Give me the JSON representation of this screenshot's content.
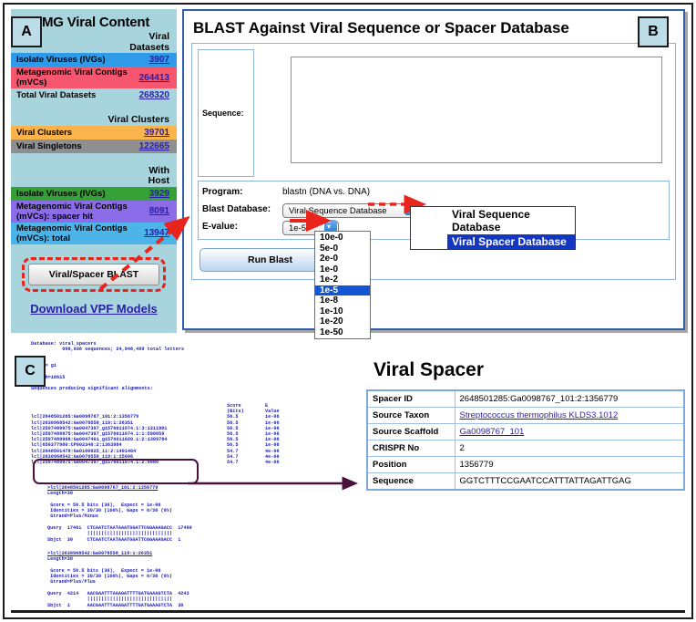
{
  "tags": {
    "a": "A",
    "b": "B",
    "c": "C"
  },
  "panel_a": {
    "title": "IMG Viral Content",
    "colheads": {
      "datasets": [
        "Viral",
        "Datasets"
      ],
      "clusters": "Viral Clusters",
      "host": [
        "With",
        "Host"
      ]
    },
    "datasets_rows": [
      {
        "label": "Isolate Viruses (IVGs)",
        "value": "3907",
        "color": "#2e9ae8"
      },
      {
        "label": "Metagenomic Viral Contigs (mVCs)",
        "value": "264413",
        "color": "#f7566f"
      },
      {
        "label": "Total Viral Datasets",
        "value": "268320",
        "color": "transparent"
      }
    ],
    "cluster_rows": [
      {
        "label": "Viral Clusters",
        "value": "39701",
        "color": "#f9b54c"
      },
      {
        "label": "Viral Singletons",
        "value": "122665",
        "color": "#8f8f8f"
      }
    ],
    "host_rows": [
      {
        "label": "Isolate Viruses (IVGs)",
        "value": "3929",
        "color": "#35a035"
      },
      {
        "label": "Metagenomic Viral Contigs (mVCs): spacer hit",
        "value": "8091",
        "color": "#8b6ce9"
      },
      {
        "label": "Metagenomic Viral Contigs (mVCs): total",
        "value": "13947",
        "color": "#4db4ea"
      }
    ],
    "blast_button": "Viral/Spacer BLAST",
    "vpf_link": "Download VPF Models"
  },
  "panel_b": {
    "title": "BLAST Against Viral Sequence or Spacer Database",
    "sequence_label": "Sequence:",
    "sequence_value": "",
    "sequence_placeholder": "",
    "program_label": "Program:",
    "program_value": "blastn (DNA vs. DNA)",
    "database_label": "Blast Database:",
    "database_value": "Viral Sequence Database",
    "database_options": [
      "Viral Sequence Database",
      "Viral Spacer Database"
    ],
    "database_selected_index": 1,
    "evalue_label": "E-value:",
    "evalue_value": "1e-5",
    "evalue_options": [
      "10e-0",
      "5e-0",
      "2e-0",
      "1e-0",
      "1e-2",
      "1e-5",
      "1e-8",
      "1e-10",
      "1e-20",
      "1e-50"
    ],
    "evalue_selected_index": 5,
    "run_button": "Run Blast"
  },
  "panel_c": {
    "header_lines": [
      "Database: viral_spacers",
      "           698,038 sequences; 24,948,499 total letters",
      "",
      "",
      "Query= gi",
      "",
      "Length=18615",
      "",
      "Sequences producing significant alignments:"
    ],
    "score_head": [
      "Score",
      "(Bits)"
    ],
    "evalue_head": [
      "E",
      "Value"
    ],
    "hits": [
      {
        "id": "lcl|2648501285:Ga0098767_101:2:1356779",
        "score": "56.5",
        "evalue": "1e-06"
      },
      {
        "id": "lcl|2630968542:Ga0078558_119:1:26351",
        "score": "56.5",
        "evalue": "1e-06"
      },
      {
        "id": "lcl|2597489975:Ga0047397_gi576011074.1:3:1311901",
        "score": "56.5",
        "evalue": "1e-06"
      },
      {
        "id": "lcl|2597489975:Ga0047397_gi576011074.1:1:590059",
        "score": "56.5",
        "evalue": "1e-06"
      },
      {
        "id": "lcl|2597489968:Ga0047401_gi576011020.1:2:1309784",
        "score": "56.5",
        "evalue": "1e-06"
      },
      {
        "id": "lcl|650377980:CP002340:2:1363984",
        "score": "56.5",
        "evalue": "1e-06"
      },
      {
        "id": "lcl|2648501478:Ga0100925_11:2:1401404",
        "score": "54.7",
        "evalue": "4e-06"
      },
      {
        "id": "lcl|2630968542:Ga0078558_119:1:25096",
        "score": "54.7",
        "evalue": "4e-06"
      },
      {
        "id": "lcl|2597489975:Ga0047397_gi576011074.1:2:9080",
        "score": "54.7",
        "evalue": "4e-06"
      }
    ],
    "alignment1": [
      ">lcl|2648501285:Ga0098767_101:2:1356779",
      "Length=30",
      "",
      " Score = 56.5 bits (30),  Expect = 1e-06",
      " Identities = 30/30 (100%), Gaps = 0/30 (0%)",
      " Strand=Plus/Minus",
      "",
      "Query  17461  CTCAATCTAATAAATGGATTCGGAAAGACC  17490",
      "              ||||||||||||||||||||||||||||||",
      "Sbjct  30     CTCAATCTAATAAATGGATTCGGAAAGACC  1"
    ],
    "alignment1_head": ">lcl|2648501285:Ga0098767_101:2:1356779",
    "alignment2": [
      ">lcl|2630968542:Ga0078558_119:1:26351",
      "Length=30",
      "",
      " Score = 56.5 bits (30),  Expect = 1e-06",
      " Identities = 30/30 (100%), Gaps = 0/30 (0%)",
      " Strand=Plus/Plus",
      "",
      "Query  4214   AACGAATTTAAAGATTTTGATGAAAGTCTA  4243",
      "              ||||||||||||||||||||||||||||||",
      "Sbjct  1      AACGAATTTAAAGATTTTGATGAAAGTCTA  30"
    ],
    "alignment2_head": ">lcl|2630968542:Ga0078558_119:1:26351",
    "spacer_card": {
      "title": "Viral Spacer",
      "rows": [
        {
          "key": "Spacer ID",
          "value": "2648501285:Ga0098767_101:2:1356779",
          "link": false
        },
        {
          "key": "Source Taxon",
          "value": "Streptococcus thermophilus KLDS3.1012",
          "link": true
        },
        {
          "key": "Source Scaffold",
          "value": "Ga0098767_101",
          "link": true
        },
        {
          "key": "CRISPR No",
          "value": "2",
          "link": false
        },
        {
          "key": "Position",
          "value": "1356779",
          "link": false
        },
        {
          "key": "Sequence",
          "value": "GGTCTTTCCGAATCCATTTATTAGATTGAG",
          "link": false
        }
      ]
    }
  },
  "colors": {
    "panel_a_bg": "#a8d5dd",
    "accent_red_dash": "#e8241c",
    "link": "#2a1ea8",
    "mono_text": "#1b1bbe",
    "highlight_box": "#4a1040",
    "select_blue": "#1256d3"
  }
}
